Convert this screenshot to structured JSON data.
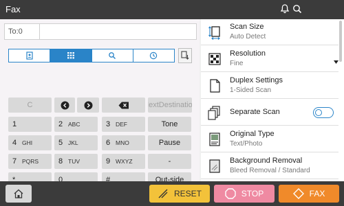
{
  "titlebar": {
    "title": "Fax"
  },
  "destination": {
    "label": "To:0"
  },
  "keys": {
    "c": "C",
    "next_destination": "NextDestination",
    "k1": {
      "num": "1",
      "letters": ""
    },
    "k2": {
      "num": "2",
      "letters": "ABC"
    },
    "k3": {
      "num": "3",
      "letters": "DEF"
    },
    "k4": {
      "num": "4",
      "letters": "GHI"
    },
    "k5": {
      "num": "5",
      "letters": "JKL"
    },
    "k6": {
      "num": "6",
      "letters": "MNO"
    },
    "k7": {
      "num": "7",
      "letters": "PQRS"
    },
    "k8": {
      "num": "8",
      "letters": "TUV"
    },
    "k9": {
      "num": "9",
      "letters": "WXYZ"
    },
    "star": "*",
    "k0": "0",
    "hash": "#",
    "tone": "Tone",
    "pause": "Pause",
    "dash": "-",
    "outside": "Out-side"
  },
  "settings": [
    {
      "title": "Scan Size",
      "value": "Auto Detect",
      "icon": "scan-size-icon"
    },
    {
      "title": "Resolution",
      "value": "Fine",
      "icon": "resolution-icon"
    },
    {
      "title": "Duplex Settings",
      "value": "1-Sided Scan",
      "icon": "duplex-icon"
    },
    {
      "title": "Separate Scan",
      "value": "",
      "icon": "separate-scan-icon",
      "toggle": false
    },
    {
      "title": "Original Type",
      "value": "Text/Photo",
      "icon": "original-type-icon"
    },
    {
      "title": "Background Removal",
      "value": "Bleed Removal / Standard",
      "icon": "background-removal-icon"
    }
  ],
  "bottom": {
    "reset": "RESET",
    "stop": "STOP",
    "fax": "FAX"
  },
  "colors": {
    "accent": "#2a84c8",
    "reset": "#f3c23a",
    "stop": "#ef8aa2",
    "fax": "#f08a2a"
  }
}
